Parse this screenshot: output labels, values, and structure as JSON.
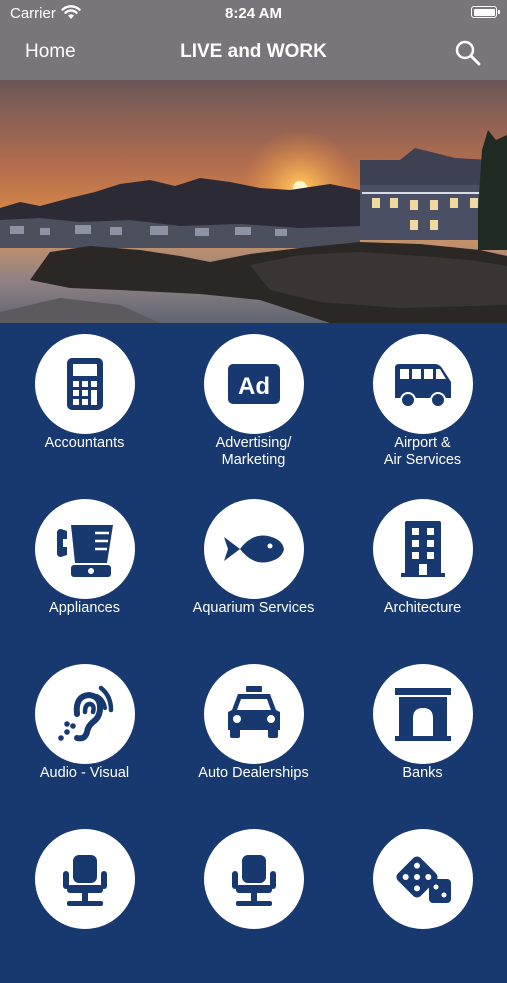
{
  "status_bar": {
    "carrier": "Carrier",
    "time": "8:24 AM"
  },
  "nav": {
    "back_label": "Home",
    "title": "LIVE and WORK"
  },
  "colors": {
    "background": "#17396f",
    "nav_bar": "#78767b",
    "icon_fg": "#17396f",
    "circle": "#ffffff",
    "text": "#ffffff"
  },
  "categories": [
    {
      "label": "Accountants",
      "icon": "calculator-icon"
    },
    {
      "label": "Advertising/\nMarketing",
      "icon": "ad-icon"
    },
    {
      "label": "Airport &\nAir Services",
      "icon": "shuttle-van-icon"
    },
    {
      "label": "Appliances",
      "icon": "blender-phone-icon"
    },
    {
      "label": "Aquarium Services",
      "icon": "fish-icon"
    },
    {
      "label": "Architecture",
      "icon": "building-icon"
    },
    {
      "label": "Audio - Visual",
      "icon": "hearing-icon"
    },
    {
      "label": "Auto Dealerships",
      "icon": "taxi-icon"
    },
    {
      "label": "Banks",
      "icon": "archway-icon"
    },
    {
      "label": "",
      "icon": "office-chair-icon"
    },
    {
      "label": "",
      "icon": "office-chair-icon"
    },
    {
      "label": "",
      "icon": "dice-icon"
    }
  ]
}
